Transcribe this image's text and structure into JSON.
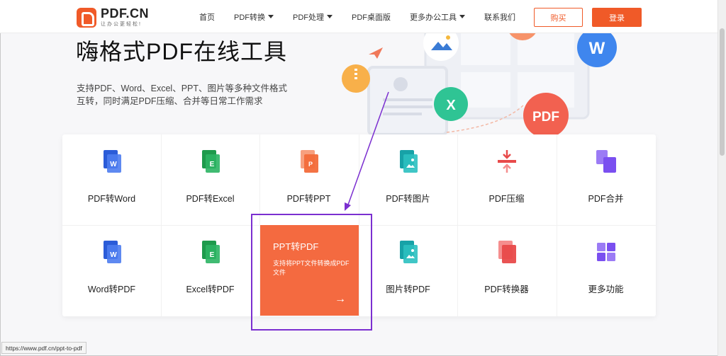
{
  "header": {
    "logo_name": "PDF.CN",
    "logo_slogan": "让办公更轻松!",
    "nav": [
      "首页",
      "PDF转换",
      "PDF处理",
      "PDF桌面版",
      "更多办公工具",
      "联系我们"
    ],
    "buy_label": "购买",
    "login_label": "登录"
  },
  "hero": {
    "title": "嗨格式PDF在线工具",
    "subtitle_line1": "支持PDF、Word、Excel、PPT、图片等多种文件格式",
    "subtitle_line2": "互转，同时满足PDF压缩、合并等日常工作需求",
    "badge_pdf": "PDF",
    "badge_w": "W",
    "badge_x": "X"
  },
  "tools": {
    "pdf_to_word": "PDF转Word",
    "pdf_to_excel": "PDF转Excel",
    "pdf_to_ppt": "PDF转PPT",
    "pdf_to_image": "PDF转图片",
    "pdf_compress": "PDF压缩",
    "pdf_merge": "PDF合并",
    "word_to_pdf": "Word转PDF",
    "excel_to_pdf": "Excel转PDF",
    "image_to_pdf": "图片转PDF",
    "pdf_converter": "PDF转换器",
    "more": "更多功能"
  },
  "feature": {
    "title": "PPT转PDF",
    "description": "支持将PPT文件转换成PDF文件",
    "arrow": "→"
  },
  "status_url": "https://www.pdf.cn/ppt-to-pdf",
  "colors": {
    "accent": "#f05a28",
    "feature_bg": "#f46a40",
    "highlight": "#7b2fd0",
    "word_blue": "#2b5cd8",
    "excel_green": "#1e9a4c",
    "ppt_orange": "#f26b3a",
    "image_teal": "#17a2a7",
    "compress_red": "#e84a4a",
    "merge_purple": "#7a4ff0"
  }
}
